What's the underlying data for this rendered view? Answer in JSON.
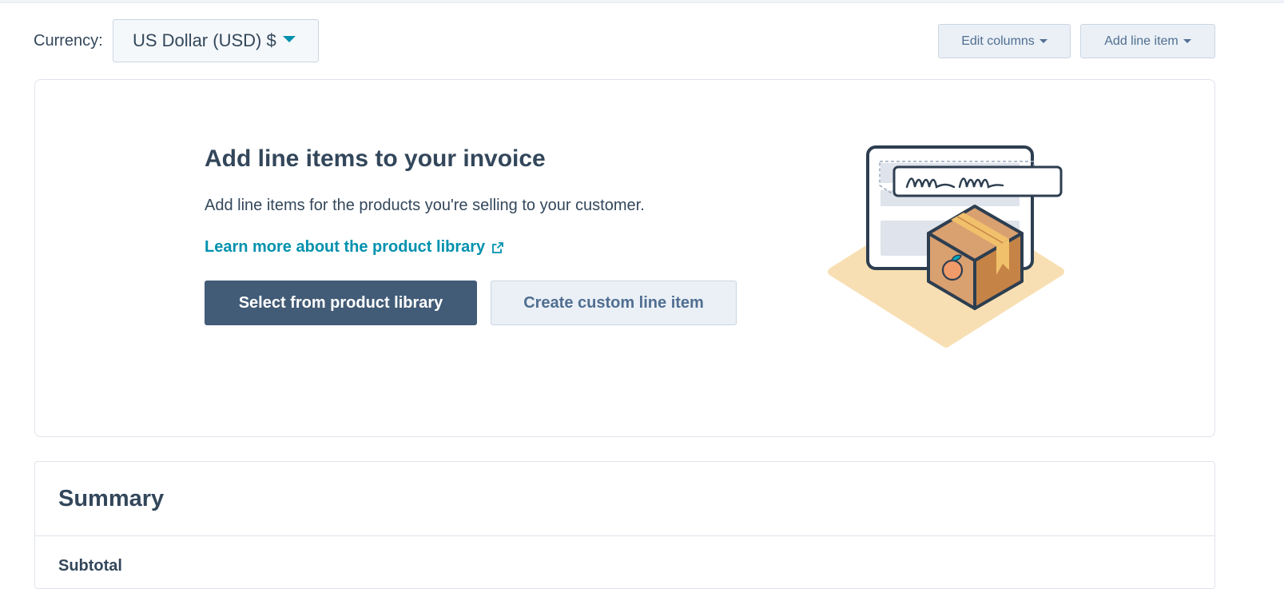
{
  "currency": {
    "label": "Currency:",
    "selected": "US Dollar (USD) $"
  },
  "toolbar": {
    "edit_columns_label": "Edit columns",
    "add_line_item_label": "Add line item"
  },
  "empty_state": {
    "title": "Add line items to your invoice",
    "description": "Add line items for the products you're selling to your customer.",
    "learn_more_link": "Learn more about the product library",
    "primary_button": "Select from product library",
    "secondary_button": "Create custom line item"
  },
  "summary": {
    "title": "Summary",
    "subtotal_label": "Subtotal"
  },
  "colors": {
    "accent": "#0091ae",
    "primary_button": "#425b76",
    "text": "#33475b"
  },
  "icons": {
    "currency_caret": "caret-down-icon",
    "external_link": "external-link-icon",
    "illustration": "product-box-invoice-illustration"
  }
}
